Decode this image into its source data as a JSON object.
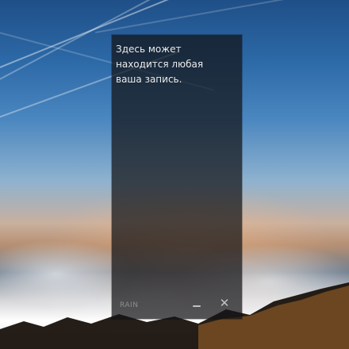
{
  "note": {
    "text": "Здесь может\nнаходится любая\nваша запись.",
    "brand": "RAIN",
    "minimize_icon": "minimize-icon",
    "close_icon": "close-icon",
    "close_glyph": "✕"
  },
  "colors": {
    "note_background": "#141416",
    "note_text": "#ffffff",
    "brand_text": "#ffffff",
    "sky_top": "#1f4f87",
    "sky_mid": "#4a86bf",
    "horizon": "#c9b09e"
  }
}
